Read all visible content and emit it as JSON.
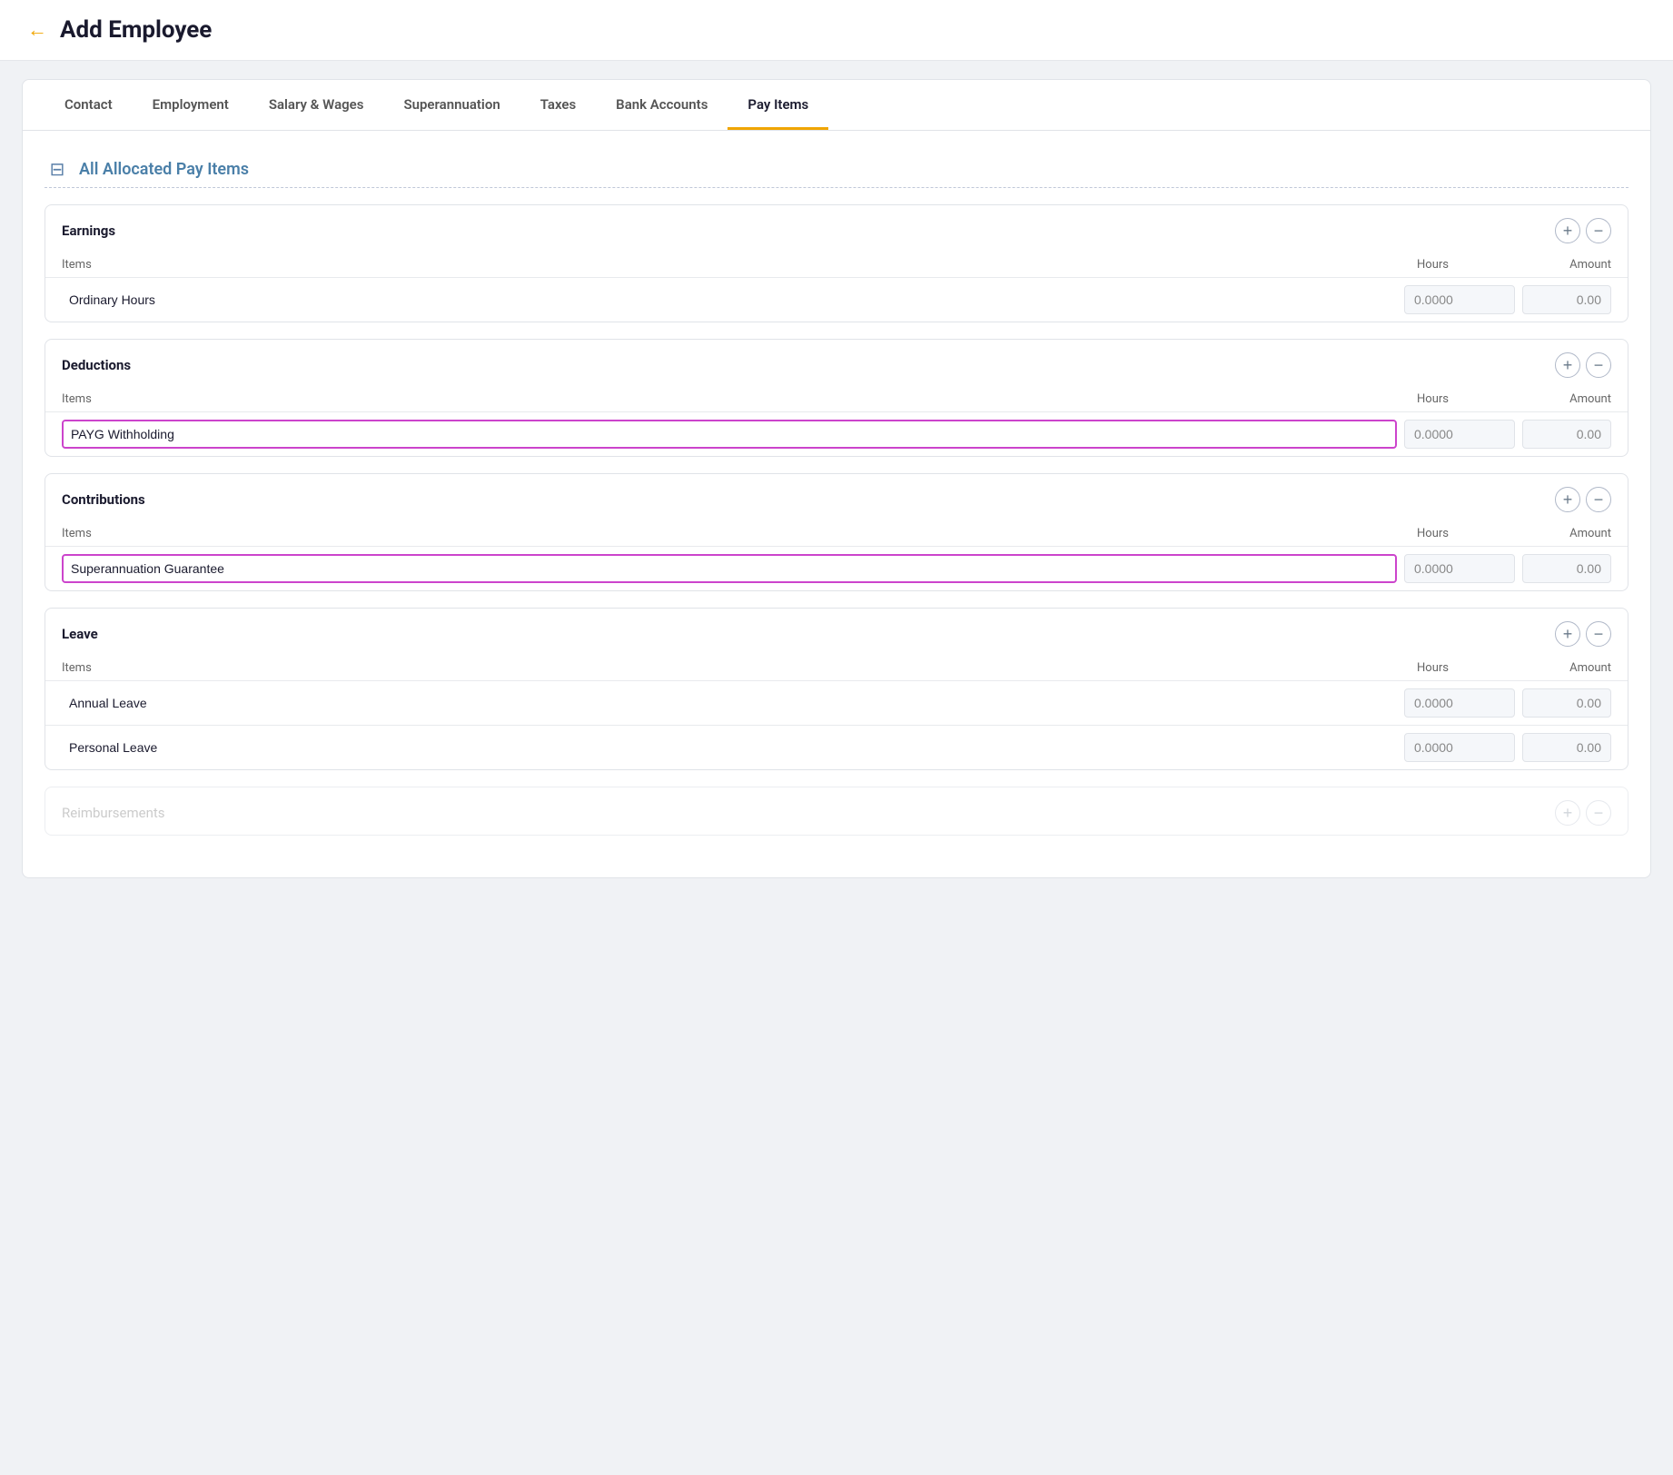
{
  "header": {
    "back_label": "←",
    "title": "Add Employee"
  },
  "tabs": [
    {
      "id": "contact",
      "label": "Contact",
      "active": false
    },
    {
      "id": "employment",
      "label": "Employment",
      "active": false
    },
    {
      "id": "salary-wages",
      "label": "Salary & Wages",
      "active": false
    },
    {
      "id": "superannuation",
      "label": "Superannuation",
      "active": false
    },
    {
      "id": "taxes",
      "label": "Taxes",
      "active": false
    },
    {
      "id": "bank-accounts",
      "label": "Bank Accounts",
      "active": false
    },
    {
      "id": "pay-items",
      "label": "Pay Items",
      "active": true
    }
  ],
  "section_heading": "All Allocated Pay Items",
  "sections": [
    {
      "id": "earnings",
      "label": "Earnings",
      "columns": {
        "items": "Items",
        "hours": "Hours",
        "amount": "Amount"
      },
      "rows": [
        {
          "item": "Ordinary Hours",
          "hours": "0.0000",
          "amount": "0.00",
          "highlighted": false
        }
      ]
    },
    {
      "id": "deductions",
      "label": "Deductions",
      "columns": {
        "items": "Items",
        "hours": "Hours",
        "amount": "Amount"
      },
      "rows": [
        {
          "item": "PAYG Withholding",
          "hours": "0.0000",
          "amount": "0.00",
          "highlighted": true
        }
      ]
    },
    {
      "id": "contributions",
      "label": "Contributions",
      "columns": {
        "items": "Items",
        "hours": "Hours",
        "amount": "Amount"
      },
      "rows": [
        {
          "item": "Superannuation Guarantee",
          "hours": "0.0000",
          "amount": "0.00",
          "highlighted": true
        }
      ]
    },
    {
      "id": "leave",
      "label": "Leave",
      "columns": {
        "items": "Items",
        "hours": "Hours",
        "amount": "Amount"
      },
      "rows": [
        {
          "item": "Annual Leave",
          "hours": "0.0000",
          "amount": "0.00",
          "highlighted": false
        },
        {
          "item": "Personal Leave",
          "hours": "0.0000",
          "amount": "0.00",
          "highlighted": false
        }
      ]
    }
  ],
  "reimbursements": {
    "label": "Reimbursements"
  },
  "icons": {
    "back": "←",
    "add": "+",
    "remove": "−",
    "section_icon": "⊟"
  }
}
